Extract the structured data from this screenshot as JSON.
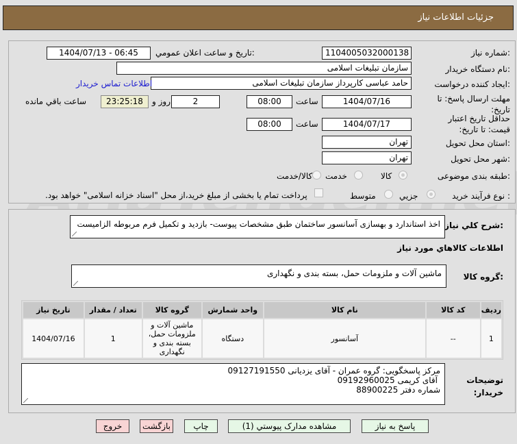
{
  "header": {
    "title": "جزئیات اطلاعات نیاز"
  },
  "form": {
    "need_number_label": "شماره نیاز:",
    "need_number": "1104005032000138",
    "announce_label": "تاریخ و ساعت اعلان عمومي:",
    "announce_value": "1404/07/13 - 06:45",
    "buyer_label": "نام دستگاه خریدار:",
    "buyer": "سازمان تبلیغات اسلامی",
    "creator_label": "ایجاد کننده درخواست:",
    "creator": "حامد عباسی کارپرداز سازمان تبلیغات اسلامی",
    "contact_link": "اطلاعات تماس خریدار",
    "deadline_label": "مهلت ارسال پاسخ: تا تاریخ:",
    "deadline_date": "1404/07/16",
    "time_label": "ساعت",
    "deadline_time": "08:00",
    "days": "2",
    "days_label": "روز و",
    "remaining": "23:25:18",
    "remaining_label": "ساعت باقي مانده",
    "validity_label": "حداقل تاریخ اعتبار قیمت: تا تاریخ:",
    "validity_date": "1404/07/17",
    "validity_time": "08:00",
    "province_label": "استان محل تحویل:",
    "province": "تهران",
    "city_label": "شهر محل تحویل:",
    "city": "تهران",
    "category_label": "طبقه بندی موضوعی:",
    "category_options": [
      "کالا",
      "خدمت",
      "کالا/خدمت"
    ],
    "category_selected": "کالا",
    "process_label": "نوع فرآیند خرید :",
    "process_options": [
      "جزیي",
      "متوسط"
    ],
    "process_selected": "جزیي",
    "payment_note": "پرداخت تمام یا بخشی از مبلغ خرید،از محل \"اسناد خزانه اسلامی\" خواهد بود."
  },
  "details": {
    "desc_label": "شرح کلي نیاز:",
    "desc": "اخذ استاندارد و بهسازی آسانسور ساختمان طبق مشخصات پیوست- بازدید و تکمیل فرم مربوطه الزامیست",
    "goods_heading": "اطلاعات کالاهاي مورد نیاز",
    "group_label": "گروه کالا:",
    "group": "ماشین آلات و ملزومات حمل، بسته بندی و نگهداری",
    "table": {
      "headers": [
        "ردیف",
        "کد کالا",
        "نام کالا",
        "واحد شمارش",
        "گروه کالا",
        "تعداد / مقدار",
        "تاریخ نیاز"
      ],
      "rows": [
        [
          "1",
          "--",
          "آسانسور",
          "دستگاه",
          "ماشین آلات و ملزومات حمل، بسته بندی و نگهداری",
          "1",
          "1404/07/16"
        ]
      ]
    },
    "notes_label": "توضیحات خریدار:",
    "notes": [
      "مرکز پاسخگویی: گروه عمران -  آقای یزدیانی 09127191550",
      "آقای کریمی  09192960025",
      "شماره دفتر   88900225"
    ]
  },
  "buttons": {
    "reply": "پاسخ به نیاز",
    "attachments": "مشاهده مدارک پیوستي (1)",
    "print": "چاپ",
    "back": "بازگشت",
    "exit": "خروج"
  },
  "watermark": "AriaTender.net"
}
